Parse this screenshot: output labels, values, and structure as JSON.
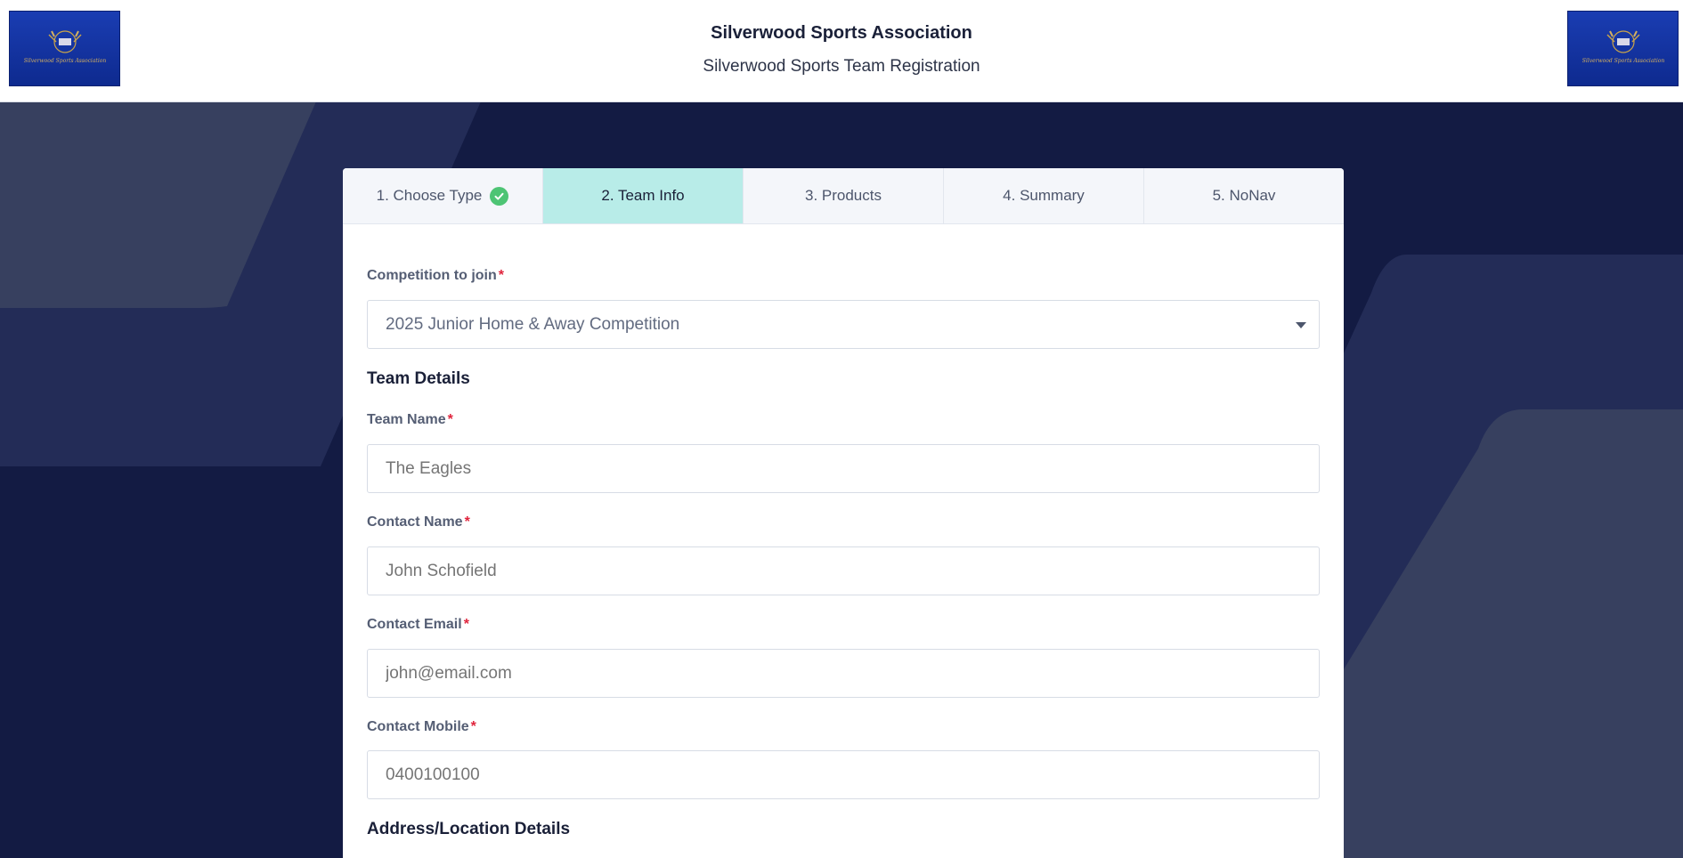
{
  "header": {
    "org_name": "Silverwood Sports Association",
    "page_subtitle": "Silverwood Sports Team Registration",
    "logo_text": "Silverwood Sports Association"
  },
  "steps": [
    {
      "label": "1. Choose Type",
      "status": "completed"
    },
    {
      "label": "2. Team Info",
      "status": "active"
    },
    {
      "label": "3. Products",
      "status": "pending"
    },
    {
      "label": "4. Summary",
      "status": "pending"
    },
    {
      "label": "5. NoNav",
      "status": "pending"
    }
  ],
  "form": {
    "required_marker": "*",
    "competition": {
      "label": "Competition to join",
      "value": "2025 Junior Home & Away Competition"
    },
    "team_details_title": "Team Details",
    "team_name": {
      "label": "Team Name",
      "placeholder": "The Eagles"
    },
    "contact_name": {
      "label": "Contact Name",
      "placeholder": "John Schofield"
    },
    "contact_email": {
      "label": "Contact Email",
      "placeholder": "john@email.com"
    },
    "contact_mobile": {
      "label": "Contact Mobile",
      "placeholder": "0400100100"
    },
    "address_title": "Address/Location Details"
  },
  "colors": {
    "page_background": "#131b43",
    "header_background": "#ffffff",
    "active_step": "#b8ece8",
    "check_badge": "#4dc474",
    "required": "#e0243c",
    "logo_blue": "#1a3db2"
  },
  "icons": {
    "step_complete": "check-circle-icon",
    "dropdown": "caret-down-icon"
  }
}
